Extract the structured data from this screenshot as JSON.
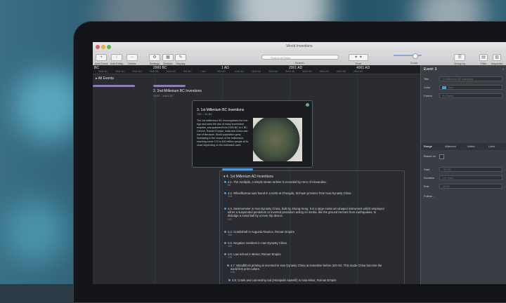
{
  "window": {
    "title": "World Inventions"
  },
  "toolbar": {
    "items": [
      {
        "label": "Add Event",
        "icon": "plus-icon"
      },
      {
        "label": "Add Entity",
        "icon": "entity-icon"
      },
      {
        "label": "Delete",
        "icon": "trash-icon"
      },
      {
        "label": "Settings",
        "icon": "gear-icon"
      },
      {
        "label": "Entities",
        "icon": "entities-icon"
      },
      {
        "label": "Display",
        "icon": "brush-icon"
      }
    ],
    "search_label": "Search",
    "search_placeholder": "Search all fields",
    "print_label": "Print",
    "zoom_label": "Zoom",
    "group_label": "Group by",
    "filter_label": "Filter",
    "inspector_label": "Inspector"
  },
  "ruler": {
    "major": [
      "BC",
      "2000 BC",
      "1 AD",
      "2001 AD",
      "4001 AD"
    ],
    "minor": [
      "3000 BC",
      "2500 BC",
      "2000 BC",
      "1500 BC",
      "1000 BC",
      "500 BC",
      "1 AD",
      "500 AD",
      "1000 AD",
      "1500 AD",
      "2000 AD",
      "2500 AD",
      "3000 AD",
      "3500 AD",
      "4000 AD",
      "4500 AD"
    ]
  },
  "all_events_label": "All Events",
  "events": {
    "e2_title": "2. 2nd Millenium BC Inventions",
    "e2_sub": "2000 – 1001 BC"
  },
  "popup": {
    "title": "3. 1st Millenium BC Inventions",
    "sub": "750 – 41 BC",
    "body": "The 1st millennium BC encompasses the Iron Age and sees the rise of many successive empires, and spanned from 1000 BC to 1 BC. Greece, Roman Europe, India and China saw rise of literature. World population grew, increasing in the course of the millennium, reaching some 170 to 400 million people at its close depending on the estimates used."
  },
  "group": {
    "title": "4. 1st Millenium AD Inventions",
    "items": [
      {
        "text": "4.1. The Aeolipile, a simple steam turbine is recorded by Hero of Alexandria.",
        "year": "50"
      },
      {
        "text": "4.2. Wheelbarrow was found in a tomb at Chengdu, Sichuan province from Han Dynasty China",
        "year": "118"
      },
      {
        "text": "4.3. Seismometer in Han Dynasty China, built by Zhang Heng. It is a large metal urn-shaped instrument which employed either a suspended pendulum or inverted pendulum acting on inertia, like the ground tremors from earthquakes, to dislodge a metal ball by a lever trip device.",
        "year": "132"
      },
      {
        "text": "4.4. Crankshaft in Augusta Raurica, Roman Empire",
        "year": "150"
      },
      {
        "text": "4.5. Negative numbers in Han Dynasty China.",
        "year": "150"
      },
      {
        "text": "4.6. Law school in Beirut, Roman Empire",
        "year": "175"
      },
      {
        "text": "4.7. Woodblock printing is invented in Han Dynasty China at sometime before 220 AD. This made China become the world first print culture.",
        "year": "210"
      },
      {
        "text": "4.8. Crank and connecting rod (Hierapolis sawmill) in Asia Minor, Roman Empire",
        "year": ""
      }
    ]
  },
  "inspector": {
    "header": "Event: 3",
    "title_label": "Title",
    "title_value": "1st Millenium BC Inventions",
    "color_label": "Color",
    "color_value": "Red",
    "parent_label": "Parent",
    "parent_value": "No Parent",
    "tabs": [
      "Range",
      "Attached",
      "Notes",
      "Links"
    ],
    "based_on_label": "Based on",
    "start_label": "Start",
    "start_value": "-750 BC",
    "duration_label": "Duration",
    "duration_value": "710 Years",
    "end_label": "End",
    "end_value": "-40 BC",
    "follow_label": "Follow..."
  }
}
